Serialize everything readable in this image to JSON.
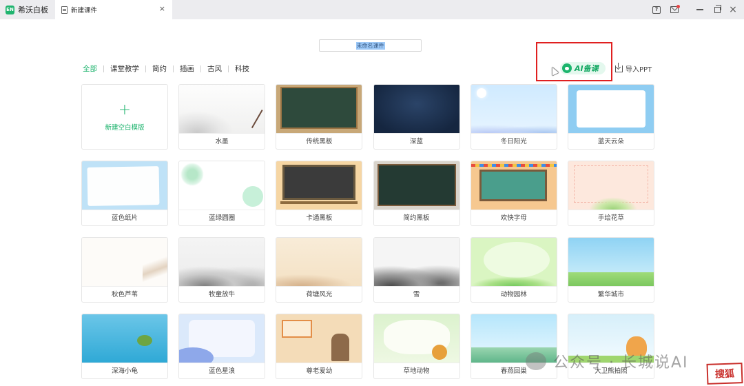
{
  "app": {
    "name": "希沃白板",
    "logo_text": "EN"
  },
  "tab": {
    "title": "新建课件",
    "close": "×"
  },
  "window": {
    "help": "?",
    "minimize": "—",
    "maximize": "",
    "close": "×"
  },
  "document": {
    "title_value": "未命名课件"
  },
  "filters": {
    "active_color": "#20b46f",
    "items": [
      "全部",
      "课堂教学",
      "简约",
      "插画",
      "古风",
      "科技"
    ]
  },
  "actions": {
    "ai_label": "AI备课",
    "import_label": "导入PPT"
  },
  "new_blank": {
    "plus": "+",
    "label": "新建空白模版"
  },
  "templates": [
    "水墨",
    "传统黑板",
    "深蓝",
    "冬日阳光",
    "蓝天云朵",
    "蓝色纸片",
    "蓝绿圆圈",
    "卡通黑板",
    "简约黑板",
    "欢快字母",
    "手绘花草",
    "秋色芦苇",
    "牧童放牛",
    "荷塘风光",
    "雪",
    "动物园林",
    "繁华城市",
    "深海小龟",
    "蓝色星浪",
    "尊老爱幼",
    "草地动物",
    "春燕回巢",
    "大卫熊拍照"
  ],
  "watermark": {
    "text": "公众号 · 长城说AI",
    "stamp": "搜狐"
  }
}
